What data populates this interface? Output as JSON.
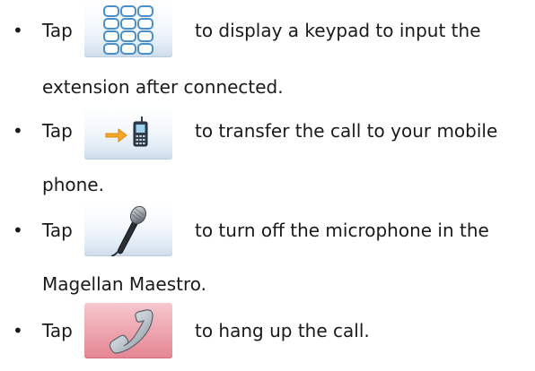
{
  "items": [
    {
      "tap_word": "Tap",
      "text": "to display a keypad to input the",
      "continuation": "extension after connected.",
      "icon": "keypad-icon"
    },
    {
      "tap_word": "Tap",
      "text": "to transfer the call to your mobile",
      "continuation": "phone.",
      "icon": "transfer-to-mobile-icon"
    },
    {
      "tap_word": "Tap",
      "text": "to turn off the microphone in the",
      "continuation": "Magellan Maestro.",
      "icon": "microphone-icon"
    },
    {
      "tap_word": "Tap",
      "text": "to hang up the call.",
      "icon": "hang-up-icon"
    }
  ],
  "bullet_char": "•",
  "colors": {
    "text": "#1a1a1a",
    "button_blue_bottom": "#cddbea",
    "button_red": "#e58593",
    "arrow_orange": "#f5a623"
  }
}
